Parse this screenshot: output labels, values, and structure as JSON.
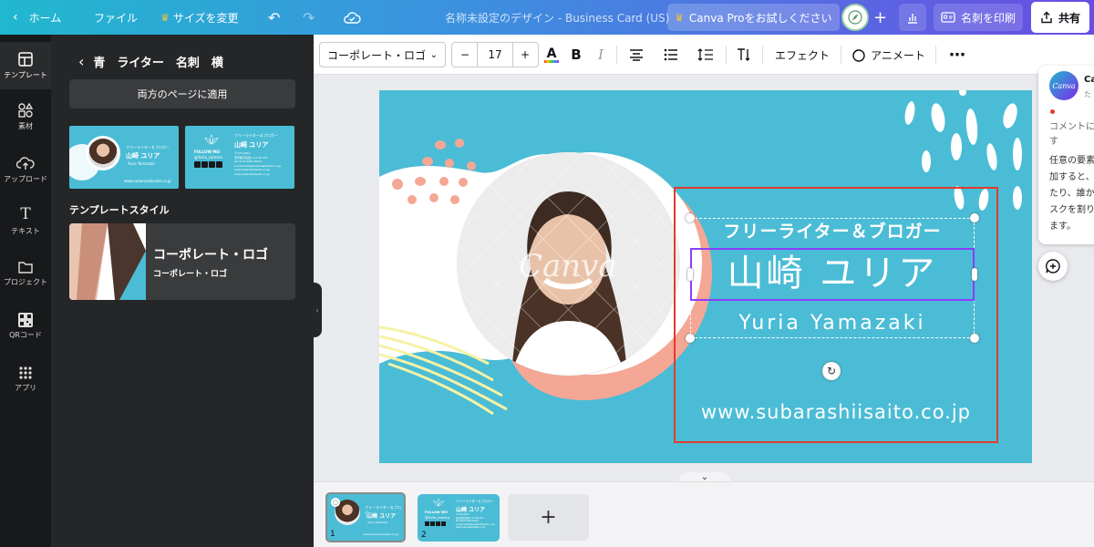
{
  "topbar": {
    "home_label": "ホーム",
    "file_label": "ファイル",
    "resize_label": "サイズを変更",
    "doc_title": "名称未設定のデザイン - Business Card (US)",
    "try_pro_label": "Canva Proをお試しください",
    "print_label": "名刺を印刷",
    "share_label": "共有"
  },
  "rail": {
    "items": [
      {
        "label": "テンプレート"
      },
      {
        "label": "素材"
      },
      {
        "label": "アップロード"
      },
      {
        "label": "テキスト"
      },
      {
        "label": "プロジェクト"
      },
      {
        "label": "QRコード"
      },
      {
        "label": "アプリ"
      }
    ]
  },
  "panel": {
    "back_title": "青　ライター　名刺　横",
    "apply_both_label": "両方のページに適用",
    "style_heading": "テンプレートスタイル",
    "style_name": "コーポレート・ロゴ",
    "style_sub": "コーポレート・ロゴ",
    "thumb1": {
      "tagline": "フリーライター＆ブロガー",
      "name": "山崎 ユリア",
      "romaji": "Yuria Yamazaki",
      "url": "www.subarashiisaito.co.jp"
    },
    "thumb2": {
      "follow": "FOLLOW ME!",
      "handle": "@Yuria_camera",
      "tagline": "フリーライター＆ブロガー",
      "name": "山崎 ユリア",
      "line1": "〒123-0011",
      "line2": "東京都渋谷区1-2-3 Bi-201",
      "line3": "tel 0123-4567-8910",
      "line4": "e-mail hello@subarashiisaito.co.jp",
      "line5": "www.subarashiisaito.co.jp",
      "line6": "www.subarashiisaito.co.jp"
    }
  },
  "toolbar": {
    "font_name": "コーポレート・ロゴ",
    "minus": "−",
    "font_size": "17",
    "plus": "+",
    "text_color_letter": "A",
    "bold": "B",
    "italic": "I",
    "effects_label": "エフェクト",
    "animate_label": "アニメート"
  },
  "card": {
    "tagline": "フリーライター＆ブロガー",
    "name": "山崎 ユリア",
    "romaji": "Yuria Yamazaki",
    "url": "www.subarashiisaito.co.jp",
    "watermark": "Canva"
  },
  "pages": {
    "page1_num": "1",
    "page2_num": "2",
    "add_label": "+"
  },
  "comments": {
    "author": "Ca",
    "time": "た",
    "avatar_text": "Canva",
    "line1": "コメントに",
    "line2": "す",
    "body1": "任意の要素",
    "body2": "加すると、",
    "body3": "たり、誰か",
    "body4": "スクを割り",
    "body5": "ます。"
  },
  "colors": {
    "card_bg": "#4bbcd5",
    "selection_red": "#e23b2e",
    "selection_purple": "#8b3dff",
    "salmon": "#f4a795",
    "pale_yellow": "#f6f2a6"
  }
}
